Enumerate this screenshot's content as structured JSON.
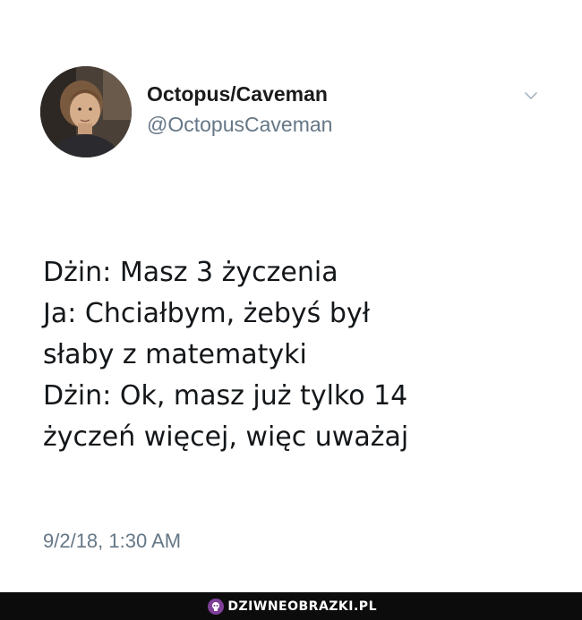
{
  "tweet": {
    "display_name": "Octopus/Caveman",
    "handle": "@OctopusCaveman",
    "text_lines": [
      "Dżin: Masz 3 życzenia",
      "Ja: Chciałbym, żebyś był",
      "słaby z matematyki",
      "Dżin: Ok, masz już tylko 14",
      "życzeń więcej, więc uważaj"
    ],
    "timestamp": "9/2/18, 1:30 AM",
    "icons": {
      "avatar": "profile-photo",
      "menu": "chevron-down-icon"
    }
  },
  "watermark": {
    "text": "DZIWNEOBRAZKI.PL",
    "icon": "skull-logo-icon"
  },
  "colors": {
    "background": "#ffffff",
    "primary_text": "#14171a",
    "secondary_text": "#657786",
    "footer_bar": "#0c0c0c",
    "watermark_accent": "#7e3f98"
  }
}
